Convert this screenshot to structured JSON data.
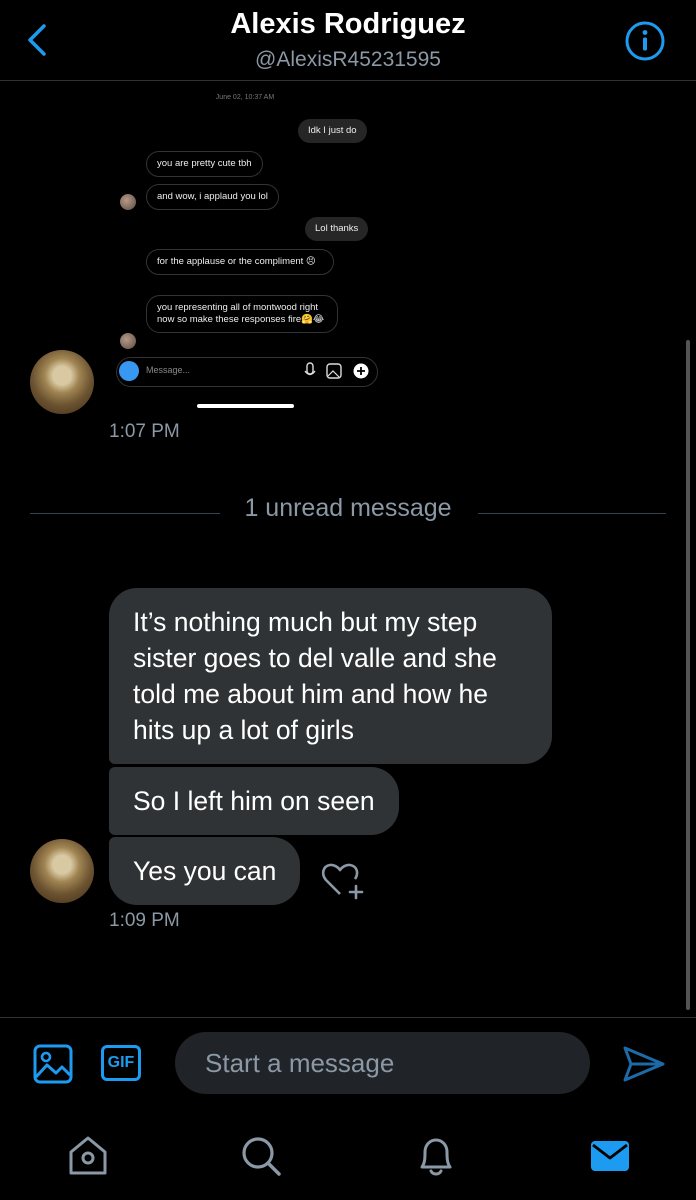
{
  "header": {
    "name": "Alexis Rodriguez",
    "handle": "@AlexisR45231595"
  },
  "shared_screenshot": {
    "date": "June 02, 10:37 AM",
    "messages": [
      {
        "text": "Idk I just do"
      },
      {
        "text": "you are pretty cute tbh"
      },
      {
        "text": "and wow, i applaud you lol"
      },
      {
        "text": "Lol thanks"
      },
      {
        "text": "for the applause or the compliment 😣"
      },
      {
        "text": "you representing all of montwood right now so make these responses fire🤗😂"
      }
    ],
    "input_placeholder": "Message..."
  },
  "conversation": {
    "time_1": "1:07 PM",
    "unread_label": "1 unread message",
    "messages": [
      {
        "text": "It’s nothing much but my step sister goes to del valle and she told me about him and how he hits up a lot of girls"
      },
      {
        "text": "So I left him on seen"
      },
      {
        "text": "Yes you can"
      }
    ],
    "time_2": "1:09 PM"
  },
  "composer": {
    "gif_label": "GIF",
    "placeholder": "Start a message"
  },
  "tabs": {
    "home": "home-icon",
    "search": "search-icon",
    "notifications": "bell-icon",
    "messages": "mail-icon"
  },
  "colors": {
    "accent": "#1d9bf0",
    "bubble": "#2f3336",
    "secondary_text": "#8b98a5"
  }
}
